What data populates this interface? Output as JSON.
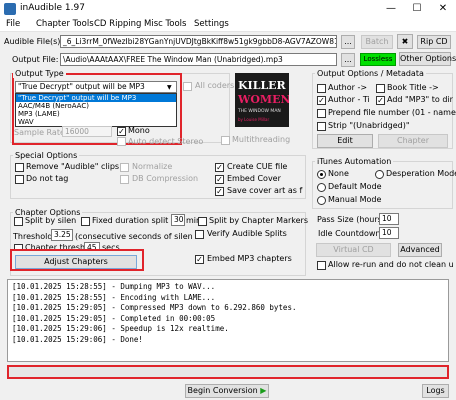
{
  "window": {
    "title": "inAudible 1.97"
  },
  "menu": [
    "File",
    "Chapter Tools",
    "CD Ripping",
    "Misc Tools",
    "Settings"
  ],
  "audible_file": {
    "label": "Audible File(s)",
    "value": "_6_Li3rrM_0fWezIbi28YGanYnjUVDJtgBkKiff8w51gk9gbbD8-AGV7AZOW81tow.aax",
    "browse": "...",
    "batch": "Batch",
    "rip_cd": "Rip CD"
  },
  "output_file": {
    "label": "Output File:",
    "value": "\\Audio\\AAAtAAX\\FREE The Window Man (Unabridged).mp3",
    "browse": "...",
    "lossless": "Lossless",
    "other_options": "Other Options"
  },
  "output_type": {
    "title": "Output Type",
    "selected": "\"True Decrypt\" output will be MP3",
    "options": [
      "\"True Decrypt\" output will be MP3",
      "AAC/M4B (NeroAAC)",
      "MP3 (LAME)",
      "WAV"
    ],
    "all_coders": "All coders",
    "sample_rate_label": "Sample Rate",
    "sample_rate": "16000",
    "mono": "Mono",
    "auto_detect": "Auto detect Stereo",
    "multithreading": "Multithreading"
  },
  "cover": {
    "line1": "KILLER",
    "line2": "WOMEN",
    "subtitle": "THE WINDOW MAN",
    "author": "by Louise Millar"
  },
  "metadata": {
    "title": "Output Options / Metadata",
    "author": "Author ->",
    "book_title": "Book Title ->",
    "author_title": "Author - Ti",
    "add_mp3": "Add \"MP3\" to dir",
    "prepend": "Prepend file number (01 - name)",
    "strip": "Strip \"(Unabridged)\"",
    "edit": "Edit",
    "chapter": "Chapter"
  },
  "special": {
    "title": "Special Options",
    "remove_clips": "Remove \"Audible\" clips",
    "normalize": "Normalize",
    "create_cue": "Create CUE file",
    "no_tag": "Do not tag",
    "db_comp": "DB Compression",
    "embed_cover": "Embed Cover",
    "save_cover": "Save cover art as f"
  },
  "itunes": {
    "title": "iTunes Automation",
    "none": "None",
    "desperation": "Desperation Mode",
    "default": "Default Mode",
    "manual": "Manual Mode"
  },
  "chapter": {
    "title": "Chapter Options",
    "split_silence": "Split by silen",
    "fixed_split": "Fixed duration split",
    "fixed_value": "30",
    "min": "min",
    "split_markers": "Split by Chapter Markers",
    "threshold_label": "Threshold",
    "threshold_value": "3.25",
    "threshold_desc": "(consecutive seconds of silen",
    "verify": "Verify Audible Splits",
    "chapter_thresh": "Chapter thresh",
    "chapter_thresh_value": "45",
    "secs": "secs",
    "adjust": "Adjust Chapters",
    "embed_mp3": "Embed MP3 chapters"
  },
  "pass": {
    "pass_size": "Pass Size (hours)",
    "pass_value": "10",
    "idle": "Idle Countdown",
    "idle_value": "10",
    "virtual_cd": "Virtual CD",
    "advanced": "Advanced",
    "allow_rerun": "Allow re-run and do not clean u"
  },
  "log": [
    "[10.01.2025 15:28:55] - Dumping MP3 to WAV...",
    "[10.01.2025 15:28:55] - Encoding with LAME...",
    "[10.01.2025 15:29:05] - Compressed MP3 down to 6.292.860 bytes.",
    "[10.01.2025 15:29:05] - Completed in 00:00:05",
    "[10.01.2025 15:29:06] - Speedup is 12x realtime.",
    "[10.01.2025 15:29:06] - Done!"
  ],
  "footer": {
    "begin": "Begin Conversion",
    "logs": "Logs"
  },
  "colors": {
    "accent_red": "#e0242b",
    "lossless_green": "#00e000",
    "selection_blue": "#0078d7"
  }
}
